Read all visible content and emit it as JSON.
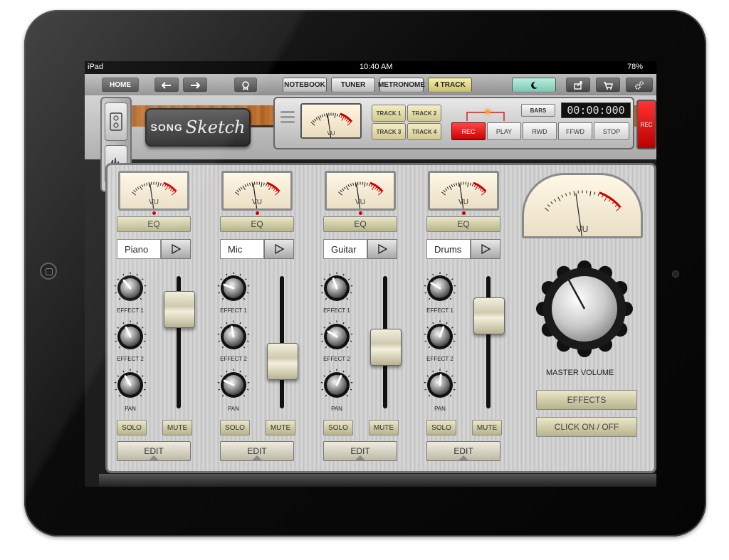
{
  "status_bar": {
    "device": "iPad",
    "time": "10:40 AM",
    "battery": "78%"
  },
  "toolbar": {
    "home_label": "HOME",
    "notebook_label": "NOTEBOOK",
    "tuner_label": "TUNER",
    "metronome_label": "METRONOME",
    "four_track_label": "4 TRACK"
  },
  "logo": {
    "song": "SONG",
    "sketch": "Sketch"
  },
  "tracks_select": [
    "TRACK 1",
    "TRACK 2",
    "TRACK 3",
    "TRACK 4"
  ],
  "transport": {
    "bars_label": "BARS",
    "timecode": "00:00:000",
    "rec_label": "REC",
    "play_label": "PLAY",
    "rwd_label": "RWD",
    "ffwd_label": "FFWD",
    "stop_label": "STOP",
    "side_rec_label": "REC"
  },
  "vu_label": "VU",
  "channels": [
    {
      "instrument": "Piano",
      "eq_label": "EQ",
      "effect1_label": "EFFECT 1",
      "effect2_label": "EFFECT 2",
      "pan_label": "PAN",
      "solo_label": "SOLO",
      "mute_label": "MUTE",
      "edit_label": "EDIT",
      "fader_level": 0.82
    },
    {
      "instrument": "Mic",
      "eq_label": "EQ",
      "effect1_label": "EFFECT 1",
      "effect2_label": "EFFECT 2",
      "pan_label": "PAN",
      "solo_label": "SOLO",
      "mute_label": "MUTE",
      "edit_label": "EDIT",
      "fader_level": 0.32
    },
    {
      "instrument": "Guitar",
      "eq_label": "EQ",
      "effect1_label": "EFFECT 1",
      "effect2_label": "EFFECT 2",
      "pan_label": "PAN",
      "solo_label": "SOLO",
      "mute_label": "MUTE",
      "edit_label": "EDIT",
      "fader_level": 0.46
    },
    {
      "instrument": "Drums",
      "eq_label": "EQ",
      "effect1_label": "EFFECT 1",
      "effect2_label": "EFFECT 2",
      "pan_label": "PAN",
      "solo_label": "SOLO",
      "mute_label": "MUTE",
      "edit_label": "EDIT",
      "fader_level": 0.76
    }
  ],
  "master": {
    "label": "MASTER VOLUME",
    "effects_label": "EFFECTS",
    "click_label": "CLICK ON / OFF"
  },
  "colors": {
    "rec_red": "#e01010",
    "led_orange": "#ff9d2e",
    "wood": "#b56a2c"
  },
  "icons": {
    "undo": "undo-arrow-icon",
    "redo": "redo-arrow-icon",
    "badge": "award-badge-icon",
    "night": "moon-icon",
    "share": "share-icon",
    "cart": "cart-icon",
    "settings": "gear-icon"
  }
}
